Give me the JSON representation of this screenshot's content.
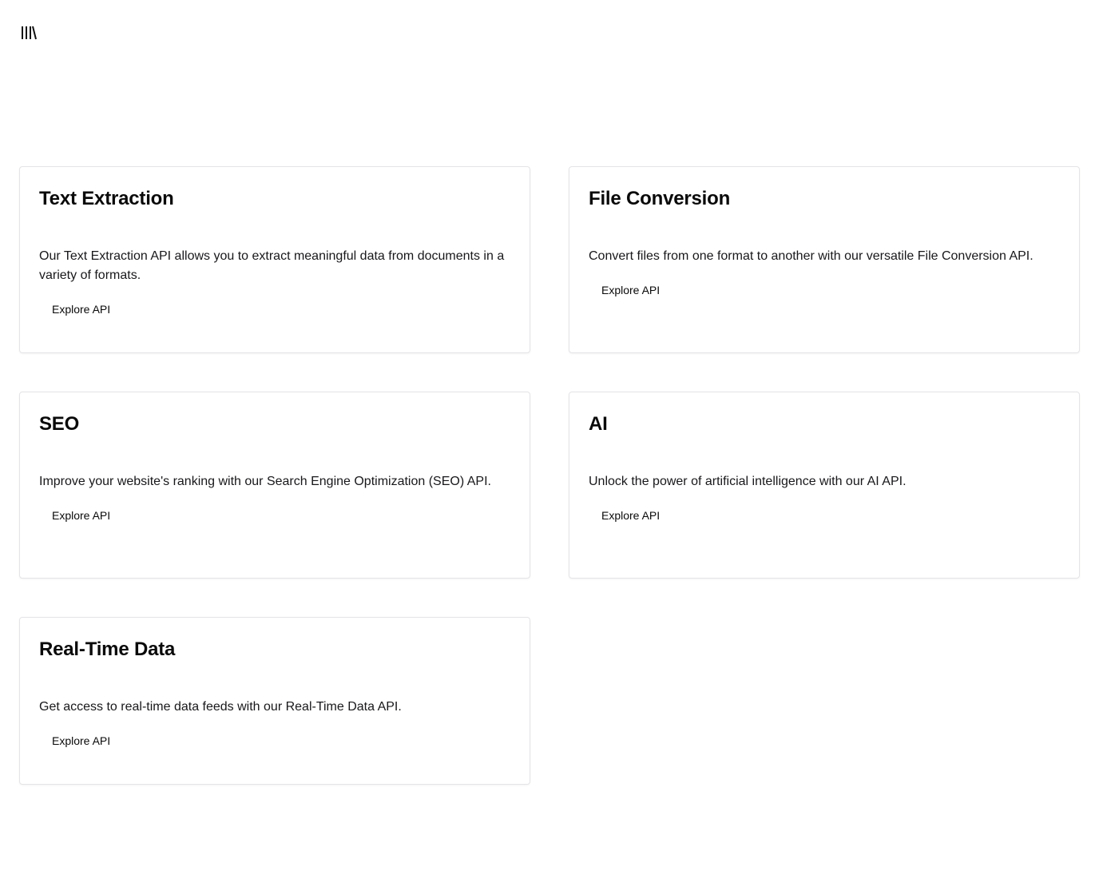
{
  "header": {
    "logo_icon": "library-icon"
  },
  "cards": [
    {
      "title": "Text Extraction",
      "description": "Our Text Extraction API allows you to extract meaningful data from documents in a variety of formats.",
      "button_label": "Explore API"
    },
    {
      "title": "File Conversion",
      "description": "Convert files from one format to another with our versatile File Conversion API.",
      "button_label": "Explore API"
    },
    {
      "title": "SEO",
      "description": "Improve your website's ranking with our Search Engine Optimization (SEO) API.",
      "button_label": "Explore API"
    },
    {
      "title": "AI",
      "description": "Unlock the power of artificial intelligence with our AI API.",
      "button_label": "Explore API"
    },
    {
      "title": "Real-Time Data",
      "description": "Get access to real-time data feeds with our Real-Time Data API.",
      "button_label": "Explore API"
    }
  ],
  "colors": {
    "background": "#ffffff",
    "text": "#111111",
    "card_border": "#e4e4e7"
  }
}
